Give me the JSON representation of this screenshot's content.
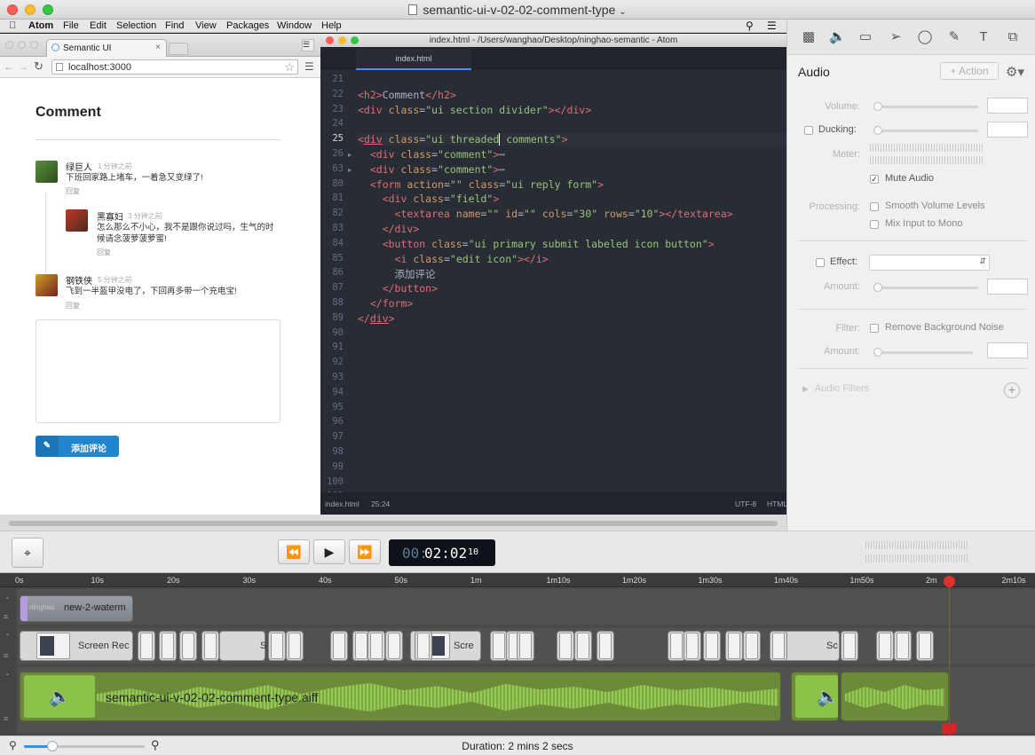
{
  "window": {
    "title": "semantic-ui-v-02-02-comment-type"
  },
  "menubar": {
    "items": [
      "Atom",
      "File",
      "Edit",
      "Selection",
      "Find",
      "View",
      "Packages",
      "Window",
      "Help"
    ]
  },
  "browser": {
    "tab_title": "Semantic UI",
    "url": "localhost:3000",
    "page_heading": "Comment",
    "comments": [
      {
        "name": "绿巨人",
        "time": "1 分钟之前",
        "text": "下班回家路上堵车，一着急又变绿了!",
        "reply": "回复"
      },
      {
        "name": "黑寡妇",
        "time": "3 分钟之前",
        "text_line1": "怎么那么不小心，我不是跟你说过吗，生气的时",
        "text_line2": "候请念菠萝菠萝蜜!",
        "reply": "回复"
      },
      {
        "name": "钢铁侠",
        "time": "5 分钟之前",
        "text": "飞到一半盔甲没电了，下回再多带一个充电宝!",
        "reply": "回复"
      }
    ],
    "submit_label": "添加评论"
  },
  "editor": {
    "window_title": "index.html - /Users/wanghao/Desktop/ninghao-semantic - Atom",
    "tab": "index.html",
    "lines": [
      {
        "n": "21",
        "html": ""
      },
      {
        "n": "22",
        "html": "<span class='t'>&lt;h2&gt;</span>Comment<span class='t'>&lt;/h2&gt;</span>"
      },
      {
        "n": "23",
        "html": "<span class='t'>&lt;div </span><span class='a'>class</span>=<span class='s'>\"ui section divider\"</span><span class='t'>&gt;&lt;/div&gt;</span>"
      },
      {
        "n": "24",
        "html": ""
      },
      {
        "n": "25",
        "html": "<span class='t'>&lt;<u>div</u> </span><span class='a'>class</span>=<span class='s'>\"ui threaded| comments\"</span><span class='t'>&gt;</span>"
      },
      {
        "n": "26",
        "html": "  <span class='t'>&lt;div </span><span class='a'>class</span>=<span class='s'>\"comment\"</span><span class='t'>&gt;</span>&#8943;"
      },
      {
        "n": "63",
        "html": "  <span class='t'>&lt;div </span><span class='a'>class</span>=<span class='s'>\"comment\"</span><span class='t'>&gt;</span>&#8943;"
      },
      {
        "n": "80",
        "html": "  <span class='t'>&lt;form </span><span class='a'>action</span>=<span class='s'>\"\"</span> <span class='a'>class</span>=<span class='s'>\"ui reply form\"</span><span class='t'>&gt;</span>"
      },
      {
        "n": "81",
        "html": "    <span class='t'>&lt;div </span><span class='a'>class</span>=<span class='s'>\"field\"</span><span class='t'>&gt;</span>"
      },
      {
        "n": "82",
        "html": "      <span class='t'>&lt;textarea </span><span class='a'>name</span>=<span class='s'>\"\"</span> <span class='a'>id</span>=<span class='s'>\"\"</span> <span class='a'>cols</span>=<span class='s'>\"30\"</span> <span class='a'>rows</span>=<span class='s'>\"10\"</span><span class='t'>&gt;&lt;/textarea&gt;</span>"
      },
      {
        "n": "83",
        "html": "    <span class='t'>&lt;/div&gt;</span>"
      },
      {
        "n": "84",
        "html": "    <span class='t'>&lt;button </span><span class='a'>class</span>=<span class='s'>\"ui primary submit labeled icon button\"</span><span class='t'>&gt;</span>"
      },
      {
        "n": "85",
        "html": "      <span class='t'>&lt;i </span><span class='a'>class</span>=<span class='s'>\"edit icon\"</span><span class='t'>&gt;&lt;/i&gt;</span>"
      },
      {
        "n": "86",
        "html": "      添加评论"
      },
      {
        "n": "87",
        "html": "    <span class='t'>&lt;/button&gt;</span>"
      },
      {
        "n": "88",
        "html": "  <span class='t'>&lt;/form&gt;</span>"
      },
      {
        "n": "89",
        "html": "<span class='t'>&lt;/<u>div</u>&gt;</span>"
      },
      {
        "n": "90",
        "html": ""
      },
      {
        "n": "91",
        "html": ""
      },
      {
        "n": "92",
        "html": ""
      },
      {
        "n": "93",
        "html": ""
      },
      {
        "n": "94",
        "html": ""
      },
      {
        "n": "95",
        "html": ""
      },
      {
        "n": "96",
        "html": ""
      },
      {
        "n": "97",
        "html": ""
      },
      {
        "n": "98",
        "html": ""
      },
      {
        "n": "99",
        "html": ""
      },
      {
        "n": "100",
        "html": ""
      },
      {
        "n": "101",
        "html": ""
      }
    ],
    "status_file": "index.html",
    "status_pos": "25:24",
    "status_encoding": "UTF-8",
    "status_grammar": "HTML"
  },
  "inspector": {
    "title": "Audio",
    "action_label": "+ Action",
    "volume_label": "Volume:",
    "ducking_label": "Ducking:",
    "meter_label": "Meter:",
    "mute_label": "Mute Audio",
    "processing_label": "Processing:",
    "smooth_label": "Smooth Volume Levels",
    "mix_label": "Mix Input to Mono",
    "effect_label": "Effect:",
    "amount_label": "Amount:",
    "filter_label": "Filter:",
    "noise_label": "Remove Background Noise",
    "audio_filters_label": "Audio Filters",
    "mute_checked": true
  },
  "transport": {
    "timer_dim": "00:",
    "timer_main": "02:02",
    "timer_frames": "10"
  },
  "ruler": {
    "ticks": [
      "0s",
      "10s",
      "20s",
      "30s",
      "40s",
      "50s",
      "1m",
      "1m10s",
      "1m20s",
      "1m30s",
      "1m40s",
      "1m50s",
      "2m",
      "2m10s"
    ]
  },
  "tracks": {
    "watermark_label": "new-2-waterm",
    "watermark_ghost": "ninghao",
    "screen_label_1": "Screen Rec",
    "screen_label_2": "Scre",
    "screen_label_3": "S",
    "screen_label_4": "Sc",
    "audio_label": "semantic-ui-v-02-02-comment-type.aiff"
  },
  "status": {
    "duration": "Duration: 2 mins 2 secs"
  },
  "colors": {
    "accent_blue": "#2185d0",
    "audio_green": "#8bc34a",
    "playhead": "#e03030"
  }
}
